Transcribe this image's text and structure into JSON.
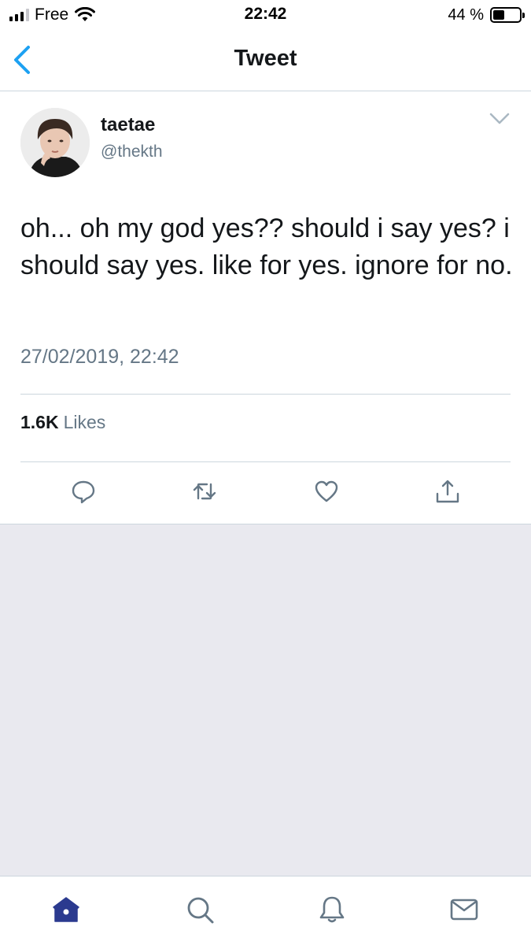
{
  "status_bar": {
    "carrier": "Free",
    "time": "22:42",
    "battery_percent": "44 %",
    "battery_level": 0.44
  },
  "nav": {
    "title": "Tweet",
    "back_icon": "chevron-left-icon"
  },
  "tweet": {
    "display_name": "taetae",
    "handle": "@thekth",
    "text": "oh... oh my god yes?? should i say yes? i should say yes. like for yes. ignore for no.",
    "timestamp": "27/02/2019, 22:42",
    "likes_count": "1.6K",
    "likes_label": "Likes",
    "actions": [
      "reply-icon",
      "retweet-icon",
      "like-icon",
      "share-icon"
    ]
  },
  "tab_bar": {
    "tabs": [
      "home-icon",
      "search-icon",
      "notifications-icon",
      "messages-icon"
    ],
    "active": "home-icon"
  },
  "colors": {
    "accent": "#1da1f2",
    "active_tab": "#2b3a8f",
    "icon_gray": "#657786",
    "background_gray": "#e9e9ef"
  }
}
